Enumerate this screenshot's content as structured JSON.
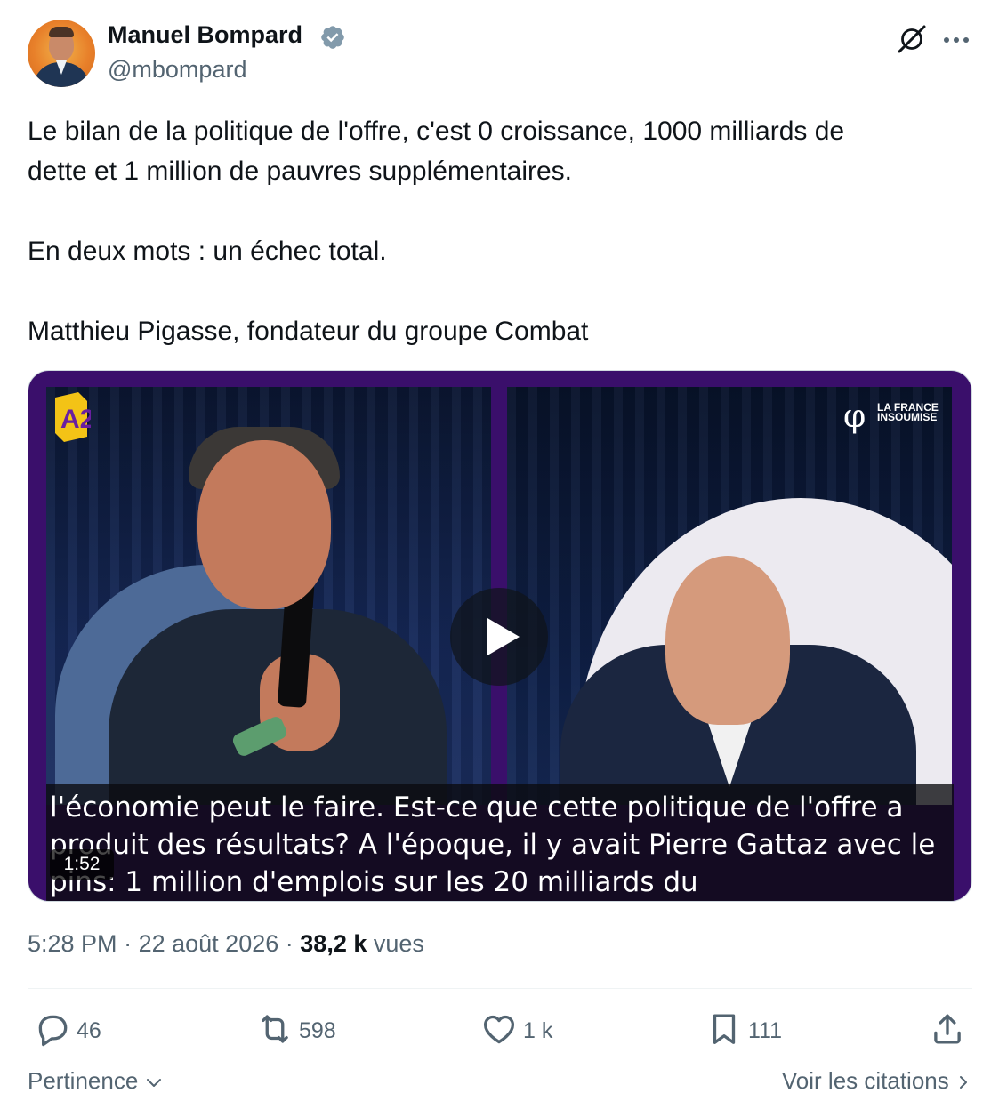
{
  "author": {
    "name": "Manuel Bompard",
    "handle": "@mbompard",
    "verified": true
  },
  "tweet": {
    "paragraphs": [
      "Le bilan de la politique de l'offre, c'est 0 croissance, 1000 milliards de",
      "dette et 1 million de pauvres supplémentaires.",
      "En deux mots : un échec total.",
      "Matthieu Pigasse, fondateur du groupe Combat"
    ]
  },
  "media": {
    "type": "video",
    "duration": "1:52",
    "channel_logo_left": "A2",
    "channel_logo_right": "LA FRANCE INSOUMISE",
    "caption_lines": [
      "l'économie peut le faire. Est-ce que cette politique de l'offre a",
      "produit des résultats? A l'époque, il y avait Pierre Gattaz avec le",
      "pins: 1 million d'emplois sur les 20 milliards du"
    ]
  },
  "meta": {
    "time": "5:28 PM",
    "separator": "·",
    "date": "22 août 2026",
    "views_count": "38,2 k",
    "views_label": "vues"
  },
  "actions": {
    "replies": "46",
    "reposts": "598",
    "likes": "1 k",
    "bookmarks": "111"
  },
  "footer": {
    "sort_label": "Pertinence",
    "quotes_label": "Voir les citations"
  },
  "icons": {
    "verified": "verified-badge-icon",
    "grok": "grok-icon",
    "more": "more-icon",
    "reply": "reply-icon",
    "repost": "repost-icon",
    "like": "heart-icon",
    "bookmark": "bookmark-icon",
    "share": "share-icon",
    "play": "play-icon"
  },
  "colors": {
    "text": "#0f1419",
    "secondary": "#536471",
    "verified": "#829aab",
    "media_frame": "#3a0f6b"
  }
}
